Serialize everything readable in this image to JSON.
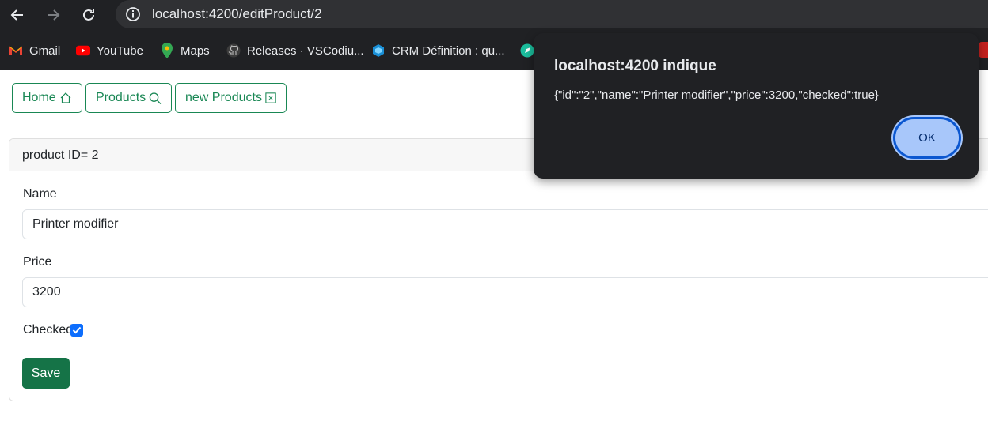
{
  "browser": {
    "url": "localhost:4200/editProduct/2",
    "bookmarks": [
      {
        "label": "Gmail",
        "icon": "gmail-icon"
      },
      {
        "label": "YouTube",
        "icon": "youtube-icon"
      },
      {
        "label": "Maps",
        "icon": "maps-icon"
      },
      {
        "label": "Releases · VSCodiu...",
        "icon": "github-icon"
      },
      {
        "label": "CRM Définition : qu...",
        "icon": "crm-icon"
      }
    ]
  },
  "nav": {
    "home_label": "Home",
    "products_label": "Products",
    "new_products_label": "new Products"
  },
  "card": {
    "header": "product ID= 2",
    "name_label": "Name",
    "name_value": "Printer modifier",
    "price_label": "Price",
    "price_value": "3200",
    "checked_label": "Checked",
    "checked": true,
    "save_label": "Save"
  },
  "alert": {
    "title": "localhost:4200 indique",
    "message": "{\"id\":\"2\",\"name\":\"Printer modifier\",\"price\":3200,\"checked\":true}",
    "ok_label": "OK"
  },
  "colors": {
    "accent_green": "#198754",
    "save_green": "#157347",
    "checkbox_blue": "#0d6efd",
    "ok_button": "#a8c7fa"
  }
}
